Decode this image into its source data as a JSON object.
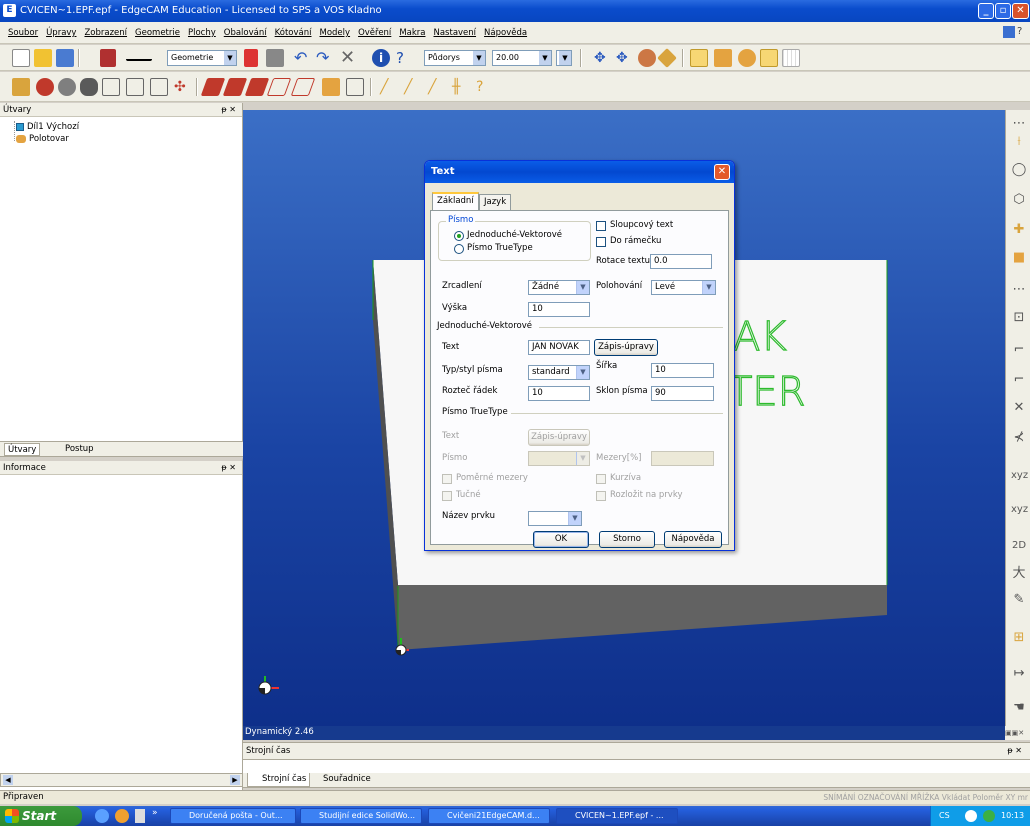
{
  "window": {
    "title": "CVICEN~1.EPF.epf - EdgeCAM Education - Licensed to SPS a VOS Kladno"
  },
  "menu": [
    "Soubor",
    "Úpravy",
    "Zobrazení",
    "Geometrie",
    "Plochy",
    "Obalování",
    "Kótování",
    "Modely",
    "Ověření",
    "Makra",
    "Nastavení",
    "Nápověda"
  ],
  "toolbar": {
    "layer": "Geometrie",
    "view": "Půdorys",
    "zoom": "20.00"
  },
  "left_panel": {
    "title": "Útvary",
    "tree": [
      "Díl1 Výchozí",
      "Polotovar"
    ],
    "tabs": [
      "Útvary",
      "Postup"
    ]
  },
  "info_panel": {
    "title": "Informace"
  },
  "viewport": {
    "status": "Dynamický 2.46",
    "scene_text": [
      "AK",
      "TER"
    ]
  },
  "bottom_panel": {
    "title": "Strojní čas",
    "tabs": [
      "Strojní čas",
      "Souřadnice"
    ]
  },
  "statusbar": {
    "text": "Připraven",
    "right": "SNÍMÁNÍ OZNAČOVÁNÍ MŘÍŽKA Vkládat Poloměr XY mr"
  },
  "dialog": {
    "title": "Text",
    "tabs": [
      "Základní",
      "Jazyk"
    ],
    "pismo_group": "Písmo",
    "radio_vector": "Jednoduché-Vektorové",
    "radio_truetype": "Písmo TrueType",
    "chk_sloupcovy": "Sloupcový text",
    "chk_ramecek": "Do rámečku",
    "rotace_label": "Rotace textu",
    "rotace_value": "0.0",
    "zrcadleni_label": "Zrcadlení",
    "zrcadleni_value": "Žádné",
    "polohovani_label": "Polohování",
    "polohovani_value": "Levé",
    "vyska_label": "Výška",
    "vyska_value": "10",
    "vector_group": "Jednoduché-Vektorové",
    "text_label": "Text",
    "text_value": "JAN NOVAK",
    "zapis_button": "Zápis-úpravy",
    "typ_label": "Typ/styl písma",
    "typ_value": "standard",
    "sirka_label": "Šířka",
    "sirka_value": "10",
    "roztec_label": "Rozteč řádek",
    "roztec_value": "10",
    "sklon_label": "Sklon písma",
    "sklon_value": "90",
    "tt_group": "Písmo TrueType",
    "tt_text_label": "Text",
    "tt_zapis_button": "Zápis-úpravy",
    "tt_pismo_label": "Písmo",
    "tt_mezery_label": "Mezery[%]",
    "tt_pomerne": "Poměrné mezery",
    "tt_kurziva": "Kurzíva",
    "tt_tucne": "Tučné",
    "tt_rozlozit": "Rozložit na prvky",
    "nazev_label": "Název prvku",
    "ok": "OK",
    "storno": "Storno",
    "napoveda": "Nápověda"
  },
  "taskbar": {
    "start": "Start",
    "tasks": [
      "Doručená pošta - Out...",
      "Studijní edice SolidWo...",
      "Cvičeni21EdgeCAM.d...",
      "CVICEN~1.EPF.epf - ..."
    ],
    "lang": "CS",
    "clock": "10:13"
  }
}
